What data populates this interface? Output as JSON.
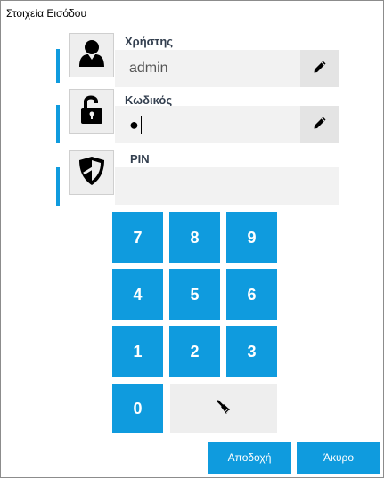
{
  "window": {
    "title": "Στοιχεία Εισόδου"
  },
  "username": {
    "label": "Χρήστης",
    "value": "admin",
    "icon": "user-icon"
  },
  "password": {
    "label": "Κωδικός",
    "masked_value": "●",
    "icon": "unlocked-padlock-icon"
  },
  "pin": {
    "label": "PIN",
    "value": "",
    "icon": "shield-icon"
  },
  "keypad": {
    "keys": [
      "7",
      "8",
      "9",
      "4",
      "5",
      "6",
      "1",
      "2",
      "3",
      "0"
    ],
    "clear_icon": "broom-icon"
  },
  "actions": {
    "accept_label": "Αποδοχή",
    "cancel_label": "Άκυρο"
  },
  "colors": {
    "accent": "#0f9bde",
    "field_background": "#f2f2f2",
    "icon_box_background": "#eeeeee"
  }
}
